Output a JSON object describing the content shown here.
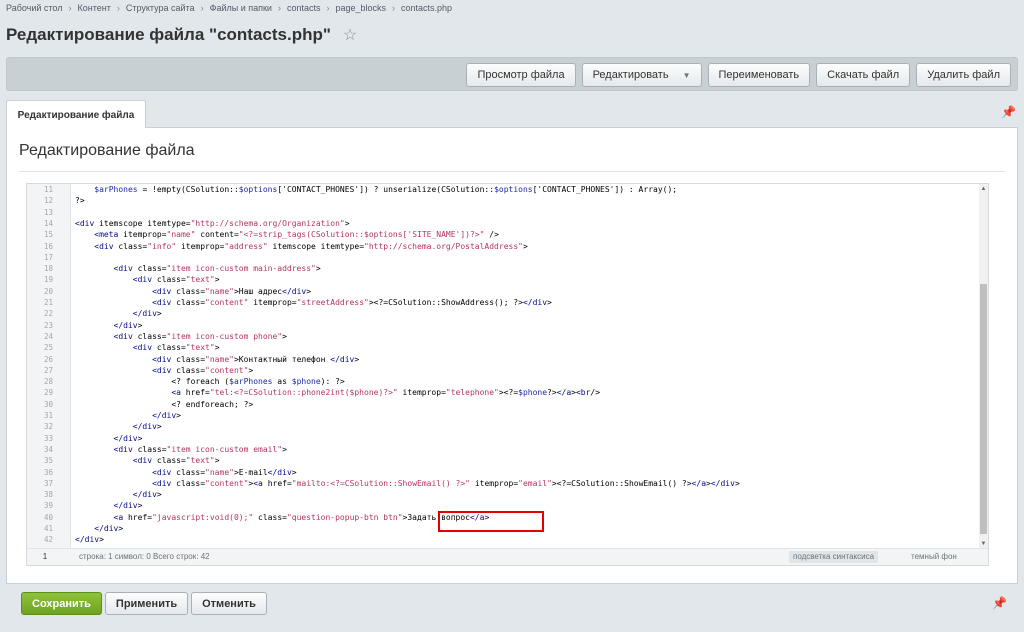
{
  "breadcrumb": [
    "Рабочий стол",
    "Контент",
    "Структура сайта",
    "Файлы и папки",
    "contacts",
    "page_blocks",
    "contacts.php"
  ],
  "page_title": "Редактирование файла \"contacts.php\"",
  "toolbar": {
    "view": "Просмотр файла",
    "edit": "Редактировать",
    "rename": "Переименовать",
    "download": "Скачать файл",
    "delete": "Удалить файл"
  },
  "tab": "Редактирование файла",
  "panel_title": "Редактирование файла",
  "editor": {
    "lines": [
      {
        "n": "11",
        "code": "    $arPhones = !empty(CSolution::$options['CONTACT_PHONES']) ? unserialize(CSolution::$options['CONTACT_PHONES']) : Array();"
      },
      {
        "n": "12",
        "code": "?>"
      },
      {
        "n": "13",
        "code": ""
      },
      {
        "n": "14",
        "code": "<div itemscope itemtype=\"http://schema.org/Organization\">"
      },
      {
        "n": "15",
        "code": "    <meta itemprop=\"name\" content=\"<?=strip_tags(CSolution::$options['SITE_NAME'])?>\" />"
      },
      {
        "n": "16",
        "code": "    <div class=\"info\" itemprop=\"address\" itemscope itemtype=\"http://schema.org/PostalAddress\">"
      },
      {
        "n": "17",
        "code": ""
      },
      {
        "n": "18",
        "code": "        <div class=\"item icon-custom main-address\">"
      },
      {
        "n": "19",
        "code": "            <div class=\"text\">"
      },
      {
        "n": "20",
        "code": "                <div class=\"name\">Наш адрес</div>"
      },
      {
        "n": "21",
        "code": "                <div class=\"content\" itemprop=\"streetAddress\"><?=CSolution::ShowAddress(); ?></div>"
      },
      {
        "n": "22",
        "code": "            </div>"
      },
      {
        "n": "23",
        "code": "        </div>"
      },
      {
        "n": "24",
        "code": "        <div class=\"item icon-custom phone\">"
      },
      {
        "n": "25",
        "code": "            <div class=\"text\">"
      },
      {
        "n": "26",
        "code": "                <div class=\"name\">Контактный телефон </div>"
      },
      {
        "n": "27",
        "code": "                <div class=\"content\">"
      },
      {
        "n": "28",
        "code": "                    <? foreach ($arPhones as $phone): ?>"
      },
      {
        "n": "29",
        "code": "                    <a href=\"tel:<?=CSolution::phone2int($phone)?>\" itemprop=\"telephone\"><?=$phone?></a><br/>"
      },
      {
        "n": "30",
        "code": "                    <? endforeach; ?>"
      },
      {
        "n": "31",
        "code": "                </div>"
      },
      {
        "n": "32",
        "code": "            </div>"
      },
      {
        "n": "33",
        "code": "        </div>"
      },
      {
        "n": "34",
        "code": "        <div class=\"item icon-custom email\">"
      },
      {
        "n": "35",
        "code": "            <div class=\"text\">"
      },
      {
        "n": "36",
        "code": "                <div class=\"name\">E-mail</div>"
      },
      {
        "n": "37",
        "code": "                <div class=\"content\"><a href=\"mailto:<?=CSolution::ShowEmail() ?>\" itemprop=\"email\"><?=CSolution::ShowEmail() ?></a></div>"
      },
      {
        "n": "38",
        "code": "            </div>"
      },
      {
        "n": "39",
        "code": "        </div>"
      },
      {
        "n": "40",
        "code": "        <a href=\"javascript:void(0);\" class=\"question-popup-btn btn\">Задать вопрос</a>"
      },
      {
        "n": "41",
        "code": "    </div>"
      },
      {
        "n": "42",
        "code": "</div>"
      }
    ],
    "status": {
      "current_line": "1",
      "position": "строка: 1    символ: 0     Всего строк: 42",
      "syntax_highlight": "подсветка синтаксиса",
      "dark_theme": "темный фон"
    }
  },
  "footer": {
    "save": "Сохранить",
    "apply": "Применить",
    "cancel": "Отменить"
  },
  "colors": {
    "save_button": "#7ab32c",
    "highlight_box": "#e50000",
    "background": "#e1e7ea"
  }
}
